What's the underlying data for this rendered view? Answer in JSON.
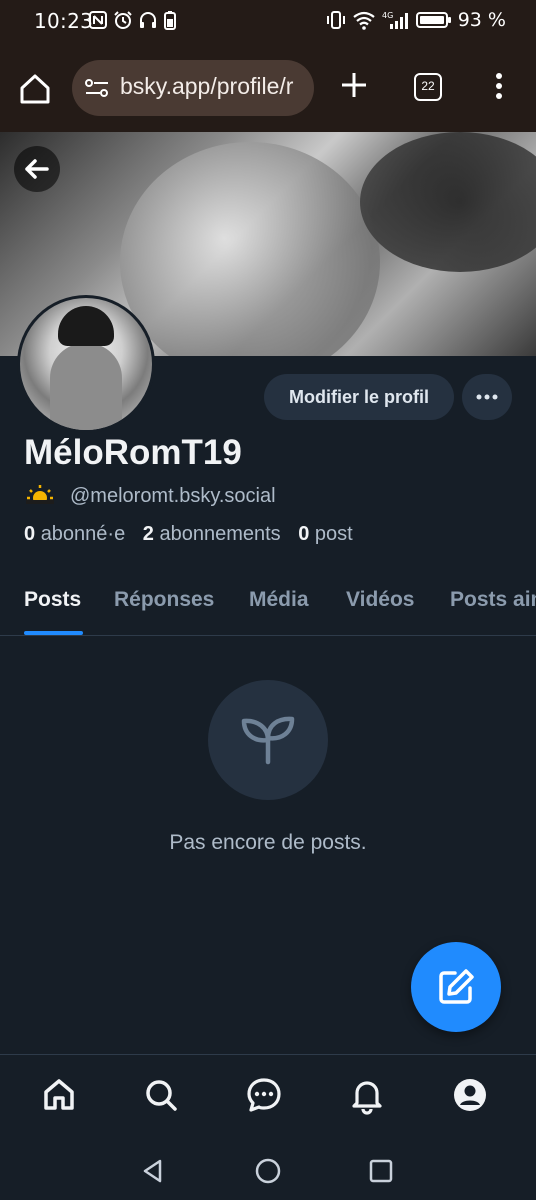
{
  "status_bar": {
    "time": "10:23",
    "network": "4G",
    "battery": "93 %"
  },
  "browser": {
    "url": "bsky.app/profile/r",
    "tab_count": "22"
  },
  "profile": {
    "edit_button": "Modifier le profil",
    "display_name": "MéloRomT19",
    "handle_emoji": "🌤",
    "handle": "@meloromt.bsky.social",
    "followers_count": "0",
    "followers_label": "abonné·e",
    "following_count": "2",
    "following_label": "abonnements",
    "posts_count": "0",
    "posts_label": "post"
  },
  "tabs": [
    {
      "label": "Posts",
      "active": true
    },
    {
      "label": "Réponses",
      "active": false
    },
    {
      "label": "Média",
      "active": false
    },
    {
      "label": "Vidéos",
      "active": false
    },
    {
      "label": "Posts aimés",
      "active": false
    }
  ],
  "empty_state": {
    "icon": "seedling-icon",
    "text": "Pas encore de posts."
  },
  "bottom_nav": [
    "home-icon",
    "search-icon",
    "chat-icon",
    "bell-icon",
    "profile-icon"
  ],
  "colors": {
    "background": "#161e27",
    "accent": "#208bfe",
    "browser_chrome": "#241b17"
  }
}
